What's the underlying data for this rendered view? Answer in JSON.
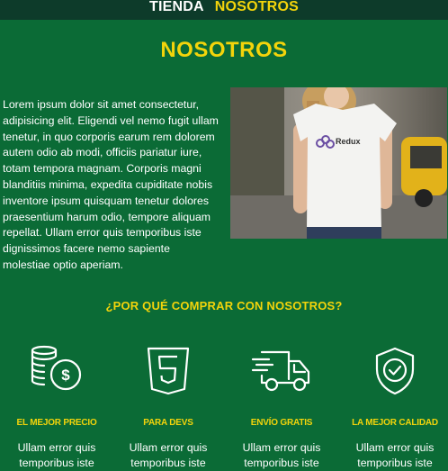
{
  "nav": {
    "items": [
      {
        "label": "TIENDA",
        "active": false
      },
      {
        "label": "NOSOTROS",
        "active": true
      }
    ]
  },
  "about": {
    "title": "NOSOTROS",
    "paragraph": "Lorem ipsum dolor sit amet consectetur, adipisicing elit. Eligendi vel nemo fugit ullam tenetur, in quo corporis earum rem dolorem autem odio ab modi, officiis pariatur iure, totam tempora magnam. Corporis magni blanditiis minima, expedita cupiditate nobis inventore ipsum quisquam tenetur dolores praesentium harum odio, tempore aliquam repellat. Ullam error quis temporibus iste dignissimos facere nemo sapiente molestiae optio aperiam.",
    "image": {
      "shirt_logo_text": "Redux"
    }
  },
  "why": {
    "title": "¿POR QUÉ COMPRAR CON NOSOTROS?",
    "features": [
      {
        "title": "EL MEJOR PRECIO",
        "icon": "coins-icon",
        "desc": "Ullam error quis temporibus iste"
      },
      {
        "title": "PARA DEVS",
        "icon": "html5-icon",
        "desc": "Ullam error quis temporibus iste"
      },
      {
        "title": "ENVÍO GRATIS",
        "icon": "delivery-truck-icon",
        "desc": "Ullam error quis temporibus iste"
      },
      {
        "title": "LA MEJOR CALIDAD",
        "icon": "shield-check-icon",
        "desc": "Ullam error quis temporibus iste"
      }
    ]
  },
  "colors": {
    "background": "#0b6b36",
    "nav_background": "#0d3b2a",
    "accent": "#f3d40b",
    "text": "#ffffff"
  }
}
